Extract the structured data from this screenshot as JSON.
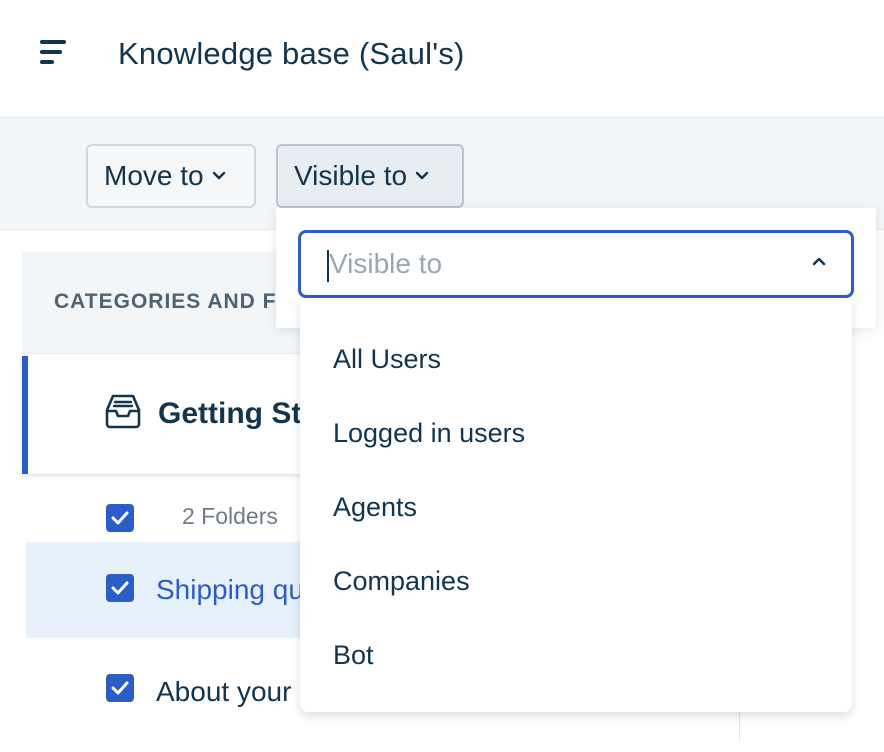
{
  "header": {
    "title": "Knowledge base (Saul's)",
    "menu_icon": "hamburger-menu-icon"
  },
  "toolbar": {
    "move_to_label": "Move to",
    "visible_to_label": "Visible to"
  },
  "panel": {
    "header_label": "CATEGORIES AND F",
    "category": {
      "title": "Getting St",
      "icon": "inbox-icon"
    },
    "folders_count_label": "2 Folders",
    "rows": [
      {
        "label": "Shipping qu",
        "selected": true
      },
      {
        "label": "About your",
        "selected": false
      }
    ]
  },
  "dropdown": {
    "search_placeholder": "Visible to",
    "search_value": "",
    "options": [
      "All Users",
      "Logged in users",
      "Agents",
      "Companies",
      "Bot"
    ]
  },
  "colors": {
    "accent": "#2c5cc5",
    "text": "#12344d",
    "muted": "#6f7c87",
    "toolbar_bg": "#f3f6f9",
    "selected_row_bg": "#e6f1fc"
  }
}
